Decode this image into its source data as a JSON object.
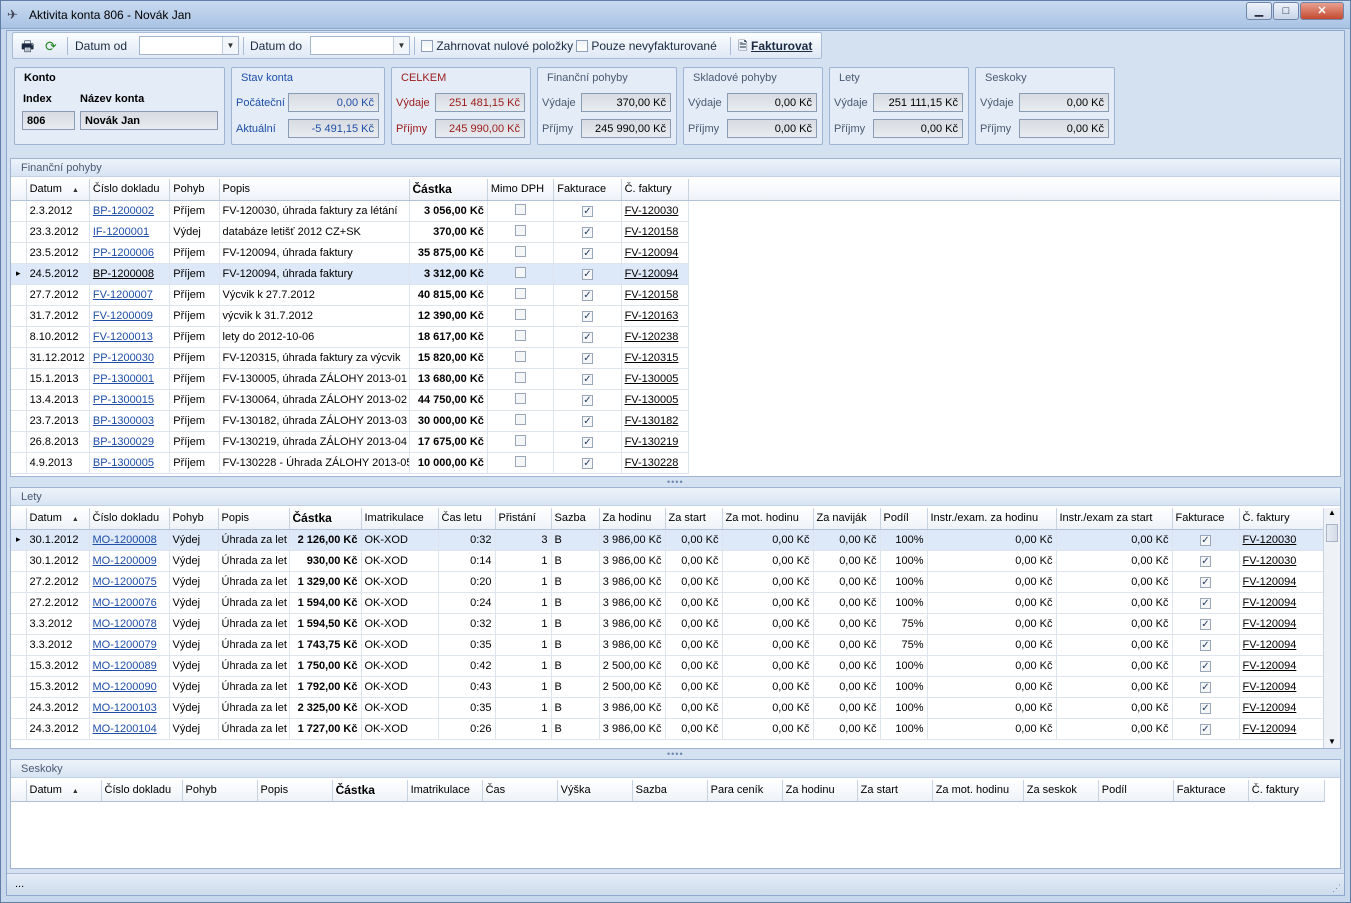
{
  "window": {
    "title": "Aktivita konta 806 - Novák Jan",
    "min": "▁",
    "max": "□",
    "close": "✕"
  },
  "toolbar": {
    "date_from_label": "Datum od",
    "date_to_label": "Datum do",
    "include_zero_label": "Zahrnovat nulové položky",
    "only_uninvoiced_label": "Pouze nevyfakturované",
    "invoice_label": "Fakturovat",
    "date_from_value": "",
    "date_to_value": ""
  },
  "konto": {
    "title": "Konto",
    "index_label": "Index",
    "name_label": "Název konta",
    "index": "806",
    "name": "Novák Jan"
  },
  "stav": {
    "title": "Stav konta",
    "start_label": "Počáteční",
    "start": "0,00 Kč",
    "current_label": "Aktuální",
    "current": "-5 491,15 Kč"
  },
  "celkem": {
    "title": "CELKEM",
    "exp_label": "Výdaje",
    "exp": "251 481,15 Kč",
    "inc_label": "Příjmy",
    "inc": "245 990,00 Kč"
  },
  "fin": {
    "title": "Finanční pohyby",
    "exp_label": "Výdaje",
    "exp": "370,00 Kč",
    "inc_label": "Příjmy",
    "inc": "245 990,00 Kč"
  },
  "sklad": {
    "title": "Skladové pohyby",
    "exp_label": "Výdaje",
    "exp": "0,00 Kč",
    "inc_label": "Příjmy",
    "inc": "0,00 Kč"
  },
  "lety": {
    "title": "Lety",
    "exp_label": "Výdaje",
    "exp": "251 111,15 Kč",
    "inc_label": "Příjmy",
    "inc": "0,00 Kč"
  },
  "seskoky": {
    "title": "Seskoky",
    "exp_label": "Výdaje",
    "exp": "0,00 Kč",
    "inc_label": "Příjmy",
    "inc": "0,00 Kč"
  },
  "fin_grid": {
    "title": "Finanční pohyby",
    "headers": [
      "Datum",
      "Číslo dokladu",
      "Pohyb",
      "Popis",
      "Částka",
      "Mimo DPH",
      "Fakturace",
      "Č. faktury"
    ],
    "rows": [
      [
        "2.3.2012",
        "BP-1200002",
        "Příjem",
        "FV-120030, úhrada faktury za létání",
        "3 056,00 Kč",
        "FV-120030"
      ],
      [
        "23.3.2012",
        "IF-1200001",
        "Výdej",
        "databáze letišť 2012 CZ+SK",
        "370,00 Kč",
        "FV-120158"
      ],
      [
        "23.5.2012",
        "PP-1200006",
        "Příjem",
        "FV-120094, úhrada faktury",
        "35 875,00 Kč",
        "FV-120094"
      ],
      [
        "24.5.2012",
        "BP-1200008",
        "Příjem",
        "FV-120094, úhrada faktury",
        "3 312,00 Kč",
        "FV-120094"
      ],
      [
        "27.7.2012",
        "FV-1200007",
        "Příjem",
        "Výcvik k 27.7.2012",
        "40 815,00 Kč",
        "FV-120158"
      ],
      [
        "31.7.2012",
        "FV-1200009",
        "Příjem",
        "výcvik k 31.7.2012",
        "12 390,00 Kč",
        "FV-120163"
      ],
      [
        "8.10.2012",
        "FV-1200013",
        "Příjem",
        "lety do 2012-10-06",
        "18 617,00 Kč",
        "FV-120238"
      ],
      [
        "31.12.2012",
        "PP-1200030",
        "Příjem",
        "FV-120315, úhrada faktury za výcvik",
        "15 820,00 Kč",
        "FV-120315"
      ],
      [
        "15.1.2013",
        "PP-1300001",
        "Příjem",
        "FV-130005, úhrada ZÁLOHY 2013-01",
        "13 680,00 Kč",
        "FV-130005"
      ],
      [
        "13.4.2013",
        "PP-1300015",
        "Příjem",
        "FV-130064, úhrada ZÁLOHY 2013-02",
        "44 750,00 Kč",
        "FV-130005"
      ],
      [
        "23.7.2013",
        "BP-1300003",
        "Příjem",
        "FV-130182, úhrada ZÁLOHY 2013-03",
        "30 000,00 Kč",
        "FV-130182"
      ],
      [
        "26.8.2013",
        "BP-1300029",
        "Příjem",
        "FV-130219, úhrada ZÁLOHY 2013-04",
        "17 675,00 Kč",
        "FV-130219"
      ],
      [
        "4.9.2013",
        "BP-1300005",
        "Příjem",
        "FV-130228 - Úhrada ZÁLOHY 2013-05",
        "10 000,00 Kč",
        "FV-130228"
      ]
    ]
  },
  "lety_grid": {
    "title": "Lety",
    "headers": [
      "Datum",
      "Číslo dokladu",
      "Pohyb",
      "Popis",
      "Částka",
      "Imatrikulace",
      "Čas letu",
      "Přistání",
      "Sazba",
      "Za hodinu",
      "Za start",
      "Za mot. hodinu",
      "Za naviják",
      "Podíl",
      "Instr./exam. za hodinu",
      "Instr./exam za start",
      "Fakturace",
      "Č. faktury"
    ],
    "rows": [
      [
        "30.1.2012",
        "MO-1200008",
        "Výdej",
        "Úhrada za let",
        "2 126,00 Kč",
        "OK-XOD",
        "0:32",
        "3",
        "B",
        "3 986,00 Kč",
        "0,00 Kč",
        "0,00 Kč",
        "0,00 Kč",
        "100%",
        "0,00 Kč",
        "0,00 Kč",
        "FV-120030"
      ],
      [
        "30.1.2012",
        "MO-1200009",
        "Výdej",
        "Úhrada za let",
        "930,00 Kč",
        "OK-XOD",
        "0:14",
        "1",
        "B",
        "3 986,00 Kč",
        "0,00 Kč",
        "0,00 Kč",
        "0,00 Kč",
        "100%",
        "0,00 Kč",
        "0,00 Kč",
        "FV-120030"
      ],
      [
        "27.2.2012",
        "MO-1200075",
        "Výdej",
        "Úhrada za let",
        "1 329,00 Kč",
        "OK-XOD",
        "0:20",
        "1",
        "B",
        "3 986,00 Kč",
        "0,00 Kč",
        "0,00 Kč",
        "0,00 Kč",
        "100%",
        "0,00 Kč",
        "0,00 Kč",
        "FV-120094"
      ],
      [
        "27.2.2012",
        "MO-1200076",
        "Výdej",
        "Úhrada za let",
        "1 594,00 Kč",
        "OK-XOD",
        "0:24",
        "1",
        "B",
        "3 986,00 Kč",
        "0,00 Kč",
        "0,00 Kč",
        "0,00 Kč",
        "100%",
        "0,00 Kč",
        "0,00 Kč",
        "FV-120094"
      ],
      [
        "3.3.2012",
        "MO-1200078",
        "Výdej",
        "Úhrada za let",
        "1 594,50 Kč",
        "OK-XOD",
        "0:32",
        "1",
        "B",
        "3 986,00 Kč",
        "0,00 Kč",
        "0,00 Kč",
        "0,00 Kč",
        "75%",
        "0,00 Kč",
        "0,00 Kč",
        "FV-120094"
      ],
      [
        "3.3.2012",
        "MO-1200079",
        "Výdej",
        "Úhrada za let",
        "1 743,75 Kč",
        "OK-XOD",
        "0:35",
        "1",
        "B",
        "3 986,00 Kč",
        "0,00 Kč",
        "0,00 Kč",
        "0,00 Kč",
        "75%",
        "0,00 Kč",
        "0,00 Kč",
        "FV-120094"
      ],
      [
        "15.3.2012",
        "MO-1200089",
        "Výdej",
        "Úhrada za let",
        "1 750,00 Kč",
        "OK-XOD",
        "0:42",
        "1",
        "B",
        "2 500,00 Kč",
        "0,00 Kč",
        "0,00 Kč",
        "0,00 Kč",
        "100%",
        "0,00 Kč",
        "0,00 Kč",
        "FV-120094"
      ],
      [
        "15.3.2012",
        "MO-1200090",
        "Výdej",
        "Úhrada za let",
        "1 792,00 Kč",
        "OK-XOD",
        "0:43",
        "1",
        "B",
        "2 500,00 Kč",
        "0,00 Kč",
        "0,00 Kč",
        "0,00 Kč",
        "100%",
        "0,00 Kč",
        "0,00 Kč",
        "FV-120094"
      ],
      [
        "24.3.2012",
        "MO-1200103",
        "Výdej",
        "Úhrada za let",
        "2 325,00 Kč",
        "OK-XOD",
        "0:35",
        "1",
        "B",
        "3 986,00 Kč",
        "0,00 Kč",
        "0,00 Kč",
        "0,00 Kč",
        "100%",
        "0,00 Kč",
        "0,00 Kč",
        "FV-120094"
      ],
      [
        "24.3.2012",
        "MO-1200104",
        "Výdej",
        "Úhrada za let",
        "1 727,00 Kč",
        "OK-XOD",
        "0:26",
        "1",
        "B",
        "3 986,00 Kč",
        "0,00 Kč",
        "0,00 Kč",
        "0,00 Kč",
        "100%",
        "0,00 Kč",
        "0,00 Kč",
        "FV-120094"
      ]
    ]
  },
  "seskoky_grid": {
    "title": "Seskoky",
    "headers": [
      "Datum",
      "Číslo dokladu",
      "Pohyb",
      "Popis",
      "Částka",
      "Imatrikulace",
      "Čas",
      "Výška",
      "Sazba",
      "Para ceník",
      "Za hodinu",
      "Za start",
      "Za mot. hodinu",
      "Za seskok",
      "Podíl",
      "Fakturace",
      "Č. faktury"
    ]
  },
  "statusbar": {
    "text": "..."
  }
}
